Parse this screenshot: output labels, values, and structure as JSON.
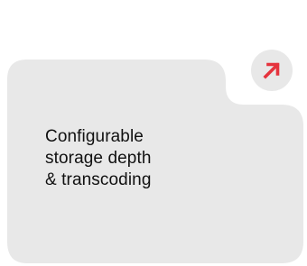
{
  "card": {
    "text": "Configurable\nstorage depth\n& transcoding",
    "background_color": "#e8e8e8",
    "text_color": "#111111"
  },
  "action": {
    "icon": "arrow-up-right-icon",
    "button_color": "#e8e8e8",
    "icon_color": "#e5333d"
  }
}
